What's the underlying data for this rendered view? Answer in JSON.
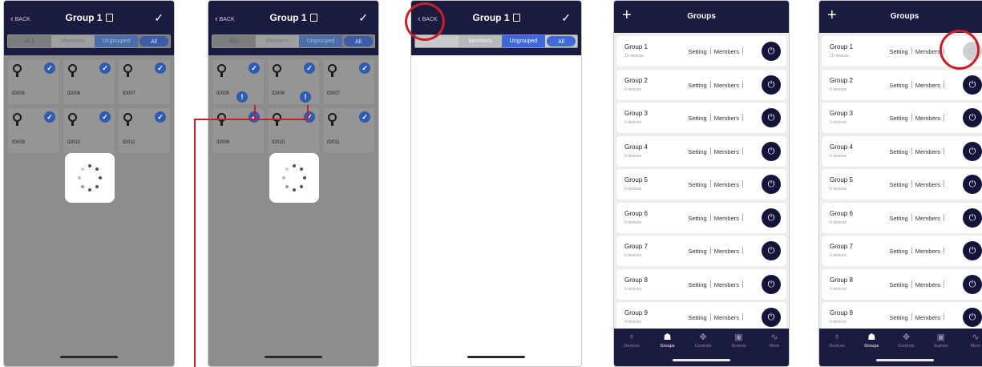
{
  "group_screen": {
    "back_label": "BACK",
    "title": "Group 1",
    "tabs": [
      "ALL",
      "Members",
      "Ungrouped",
      "All"
    ]
  },
  "device_cards": [
    {
      "id": "ID005"
    },
    {
      "id": "ID006"
    },
    {
      "id": "ID007"
    },
    {
      "id": "ID009"
    },
    {
      "id": "ID010"
    },
    {
      "id": "ID011"
    }
  ],
  "groups_screen": {
    "title": "Groups",
    "setting_label": "Setting",
    "members_label": "Members",
    "groups": [
      {
        "name": "Group 1",
        "count": "10 devices"
      },
      {
        "name": "Group 2",
        "count": "0 devices"
      },
      {
        "name": "Group 3",
        "count": "0 devices"
      },
      {
        "name": "Group 4",
        "count": "0 devices"
      },
      {
        "name": "Group 5",
        "count": "0 devices"
      },
      {
        "name": "Group 6",
        "count": "0 devices"
      },
      {
        "name": "Group 7",
        "count": "0 devices"
      },
      {
        "name": "Group 8",
        "count": "0 devices"
      },
      {
        "name": "Group 9",
        "count": "0 devices"
      }
    ],
    "nav": [
      {
        "label": "Devices",
        "icon": "bulb-icon"
      },
      {
        "label": "Groups",
        "icon": "groups-icon"
      },
      {
        "label": "Controls",
        "icon": "controls-icon"
      },
      {
        "label": "Scenes",
        "icon": "scenes-icon"
      },
      {
        "label": "More",
        "icon": "more-icon"
      }
    ],
    "active_nav": "Groups"
  },
  "colors": {
    "header": "#1b1a3f",
    "accent_blue": "#3d6ad6",
    "highlight_red": "#c8202a"
  }
}
